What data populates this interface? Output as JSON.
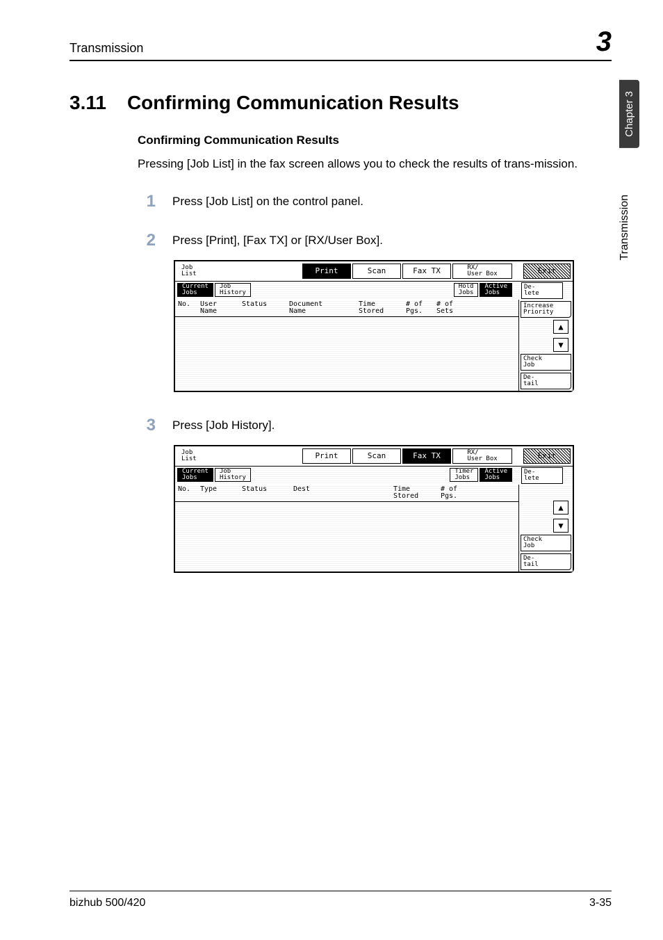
{
  "header": {
    "section": "Transmission",
    "chapter_num": "3"
  },
  "section": {
    "number": "3.11",
    "title": "Confirming Communication Results"
  },
  "subtitle": "Confirming Communication Results",
  "intro": "Pressing [Job List] in the fax screen allows you to check the results of trans-mission.",
  "steps": {
    "s1": {
      "num": "1",
      "text": "Press [Job List] on the control panel."
    },
    "s2": {
      "num": "2",
      "text": "Press [Print], [Fax TX] or [RX/User Box]."
    },
    "s3": {
      "num": "3",
      "text": "Press [Job History]."
    }
  },
  "lcd_common": {
    "job_list": "Job\nList",
    "print": "Print",
    "scan": "Scan",
    "fax_tx": "Fax TX",
    "rx_user_box": "RX/\nUser Box",
    "exit": "Exit",
    "current_jobs": "Current\nJobs",
    "job_history": "Job\nHistory",
    "active_jobs": "Active\nJobs",
    "delete": "De-\nlete",
    "increase_priority": "Increase\nPriority",
    "check_job": "Check\nJob",
    "detail": "De-\ntail",
    "up_arrow": "▲",
    "down_arrow": "▼"
  },
  "lcd1": {
    "hold_jobs": "Hold\nJobs",
    "cols": {
      "no": "No.",
      "user_name": "User\nName",
      "status": "Status",
      "doc_name": "Document\nName",
      "time_stored": "Time\nStored",
      "pgs": "# of\nPgs.",
      "sets": "# of\nSets"
    }
  },
  "lcd2": {
    "timer_jobs": "Timer\nJobs",
    "cols": {
      "no": "No.",
      "type": "Type",
      "status": "Status",
      "dest": "Dest",
      "time_stored": "Time\nStored",
      "pgs": "# of\nPgs."
    }
  },
  "side": {
    "chapter_tab": "Chapter 3",
    "running": "Transmission"
  },
  "footer": {
    "model": "bizhub 500/420",
    "page": "3-35"
  }
}
